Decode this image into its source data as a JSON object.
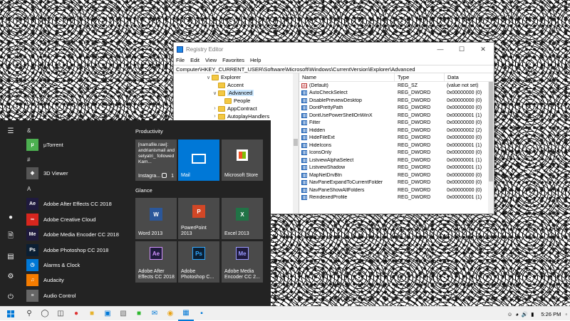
{
  "regedit": {
    "title": "Registry Editor",
    "menu": [
      "File",
      "Edit",
      "View",
      "Favorites",
      "Help"
    ],
    "address": "Computer\\HKEY_CURRENT_USER\\Software\\Microsoft\\Windows\\CurrentVersion\\Explorer\\Advanced",
    "tree": [
      "Explorer",
      "Accent",
      "Advanced",
      "People",
      "AppContract",
      "AutoplayHandlers"
    ],
    "columns": [
      "Name",
      "Type",
      "Data"
    ],
    "values": [
      {
        "name": "(Default)",
        "type": "REG_SZ",
        "data": "(value not set)"
      },
      {
        "name": "AutoCheckSelect",
        "type": "REG_DWORD",
        "data": "0x00000000 (0)"
      },
      {
        "name": "DisablePreviewDesktop",
        "type": "REG_DWORD",
        "data": "0x00000000 (0)"
      },
      {
        "name": "DontPrettyPath",
        "type": "REG_DWORD",
        "data": "0x00000000 (0)"
      },
      {
        "name": "DontUsePowerShellOnWinX",
        "type": "REG_DWORD",
        "data": "0x00000001 (1)"
      },
      {
        "name": "Filter",
        "type": "REG_DWORD",
        "data": "0x00000000 (0)"
      },
      {
        "name": "Hidden",
        "type": "REG_DWORD",
        "data": "0x00000002 (2)"
      },
      {
        "name": "HideFileExt",
        "type": "REG_DWORD",
        "data": "0x00000000 (0)"
      },
      {
        "name": "HideIcons",
        "type": "REG_DWORD",
        "data": "0x00000001 (1)"
      },
      {
        "name": "IconsOnly",
        "type": "REG_DWORD",
        "data": "0x00000000 (0)"
      },
      {
        "name": "ListviewAlphaSelect",
        "type": "REG_DWORD",
        "data": "0x00000001 (1)"
      },
      {
        "name": "ListviewShadow",
        "type": "REG_DWORD",
        "data": "0x00000001 (1)"
      },
      {
        "name": "MapNetDrvBtn",
        "type": "REG_DWORD",
        "data": "0x00000000 (0)"
      },
      {
        "name": "NavPaneExpandToCurrentFolder",
        "type": "REG_DWORD",
        "data": "0x00000000 (0)"
      },
      {
        "name": "NavPaneShowAllFolders",
        "type": "REG_DWORD",
        "data": "0x00000000 (0)"
      },
      {
        "name": "ReindexedProfile",
        "type": "REG_DWORD",
        "data": "0x00000001 (1)"
      }
    ]
  },
  "start": {
    "apps": [
      {
        "letter": "&"
      },
      {
        "name": "µTorrent",
        "icon": "utorrent-icon",
        "color": "#4caf50",
        "glyph": "µ"
      },
      {
        "letter": "#"
      },
      {
        "name": "3D Viewer",
        "icon": "3d-viewer-icon",
        "color": "#555555",
        "glyph": "◈"
      },
      {
        "letter": "A"
      },
      {
        "name": "Adobe After Effects CC 2018",
        "icon": "after-effects-icon",
        "color": "#1f1a3d",
        "glyph": "Ae"
      },
      {
        "name": "Adobe Creative Cloud",
        "icon": "creative-cloud-icon",
        "color": "#d8261e",
        "glyph": "∞"
      },
      {
        "name": "Adobe Media Encoder CC 2018",
        "icon": "media-encoder-icon",
        "color": "#1f1a3d",
        "glyph": "Me"
      },
      {
        "name": "Adobe Photoshop CC 2018",
        "icon": "photoshop-icon",
        "color": "#0b1f33",
        "glyph": "Ps"
      },
      {
        "name": "Alarms & Clock",
        "icon": "alarm-clock-icon",
        "color": "#0078d7",
        "glyph": "◷"
      },
      {
        "name": "Audacity",
        "icon": "audacity-icon",
        "color": "#f57c00",
        "glyph": "♫"
      },
      {
        "name": "Audio Control",
        "icon": "audio-control-icon",
        "color": "#666666",
        "glyph": "≡"
      }
    ],
    "groups": [
      "Productivity",
      "Glance"
    ],
    "tiles": {
      "instagram_text": "[namafile.raw]: andrianismail and setyatri_ followed Kam...",
      "instagram_label": "Instagra...",
      "instagram_count": "1",
      "mail": "Mail",
      "store": "Microsoft Store",
      "word": "Word 2013",
      "powerpoint": "PowerPoint 2013",
      "excel": "Excel 2013",
      "aftereffects": "Adobe After Effects CC 2018",
      "photoshop": "Adobe Photoshop C...",
      "mediaencoder": "Adobe Media Encoder CC 2..."
    }
  },
  "taskbar": {
    "clock": "5:26 PM"
  },
  "colors": {
    "accent": "#0078d7",
    "start_bg": "#232323",
    "tile_bg": "#4a4a4a"
  }
}
